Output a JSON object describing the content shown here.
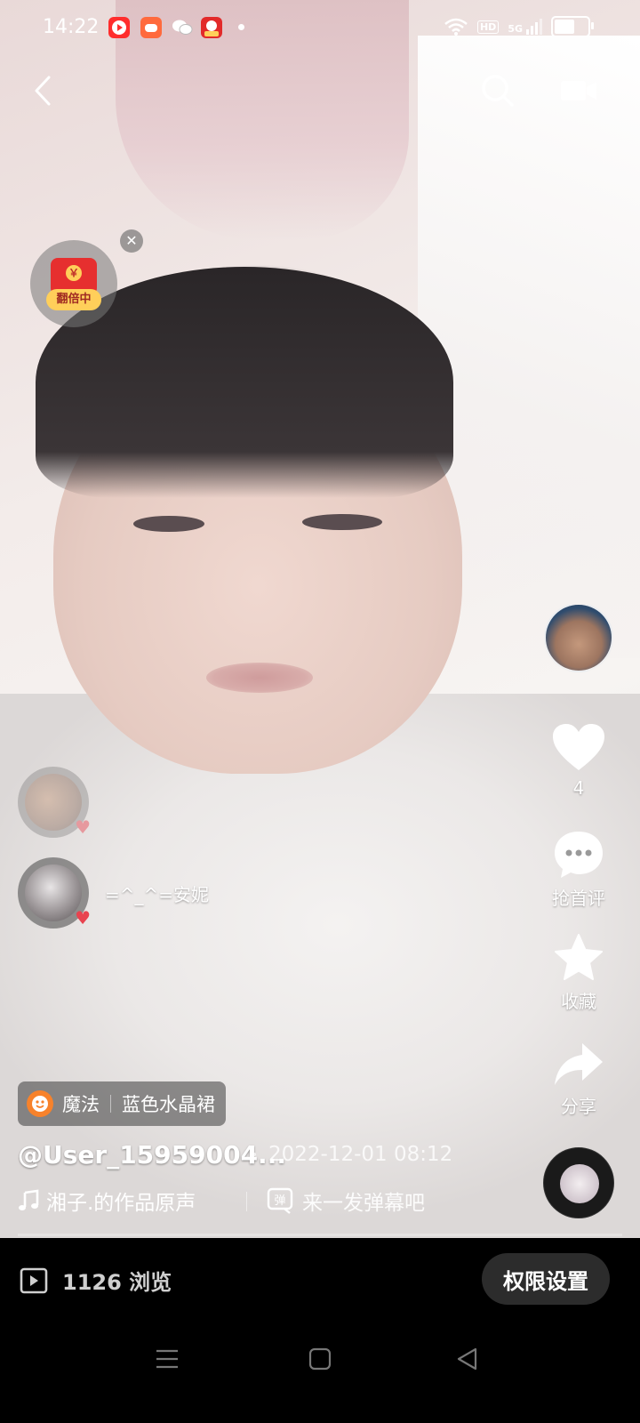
{
  "status_bar": {
    "time": "14:22",
    "network_badge": "HD",
    "network_type": "5G",
    "battery_level": 0.6
  },
  "top_nav": {
    "back_icon": "chevron-left-icon",
    "search_icon": "search-icon",
    "camera_icon": "video-camera-icon"
  },
  "red_packet": {
    "label": "翻倍中",
    "coin": "￥"
  },
  "right_rail": {
    "like_count": "4",
    "comment_label": "抢首评",
    "favorite_label": "收藏",
    "share_label": "分享"
  },
  "comment_floaters": [
    {
      "name": "=^_^=安妮"
    }
  ],
  "info": {
    "magic_label": "魔法",
    "magic_effect": "蓝色水晶裙",
    "author": "@User_15959004...",
    "date": "2022-12-01 08:12",
    "music": "湘子.的作品原声",
    "danmu_placeholder": "来一发弹幕吧"
  },
  "bottom_bar": {
    "views": "1126 浏览",
    "permission_button": "权限设置"
  },
  "colors": {
    "like_red": "#e8434f",
    "magic_orange": "#f7822b",
    "redpacket_red": "#e62f2f",
    "redpacket_gold": "#ffcf5a"
  }
}
